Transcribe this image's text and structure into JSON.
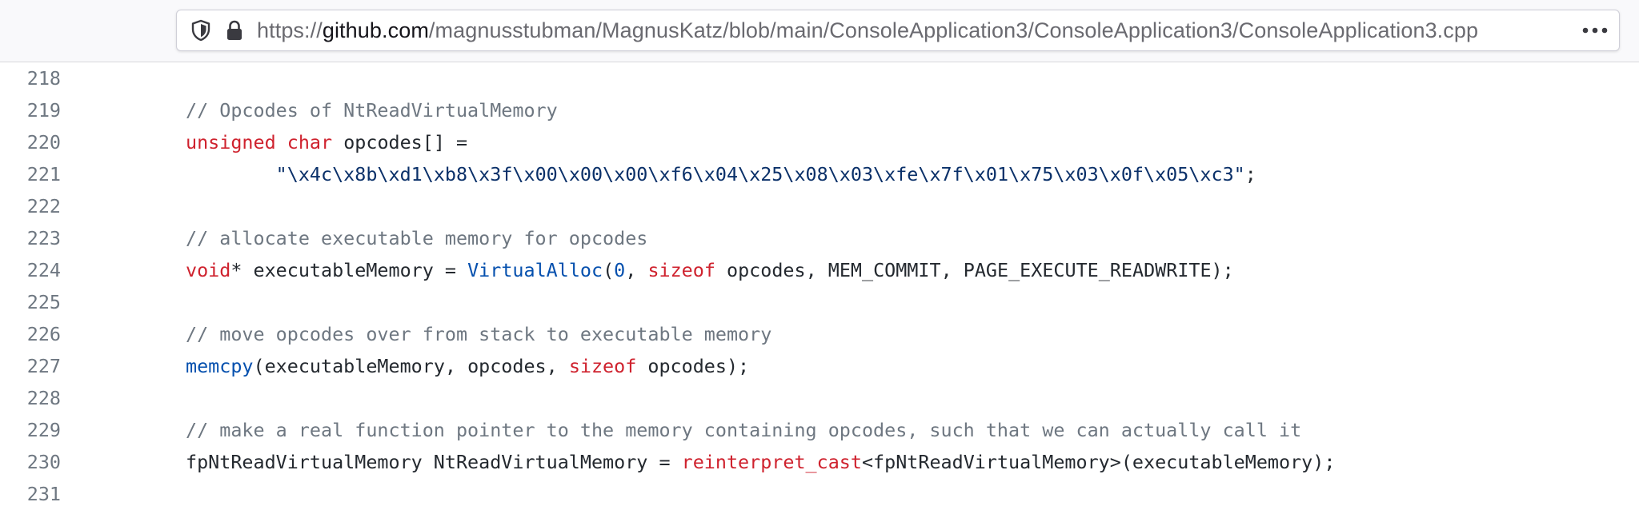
{
  "browser": {
    "url_prefix": "https://",
    "url_host": "github.com",
    "url_path": "/magnusstubman/MagnusKatz/blob/main/ConsoleApplication3/ConsoleApplication3/ConsoleApplication3.cpp",
    "icons": {
      "shield": "tracking-protection-shield-icon",
      "lock": "lock-icon",
      "menu": "more-horizontal-icon"
    }
  },
  "colors": {
    "comment": "#6e7781",
    "keyword": "#cf222e",
    "function": "#0550ae",
    "string": "#0a3069",
    "text": "#24292f",
    "line_number": "#6e7781"
  },
  "code": {
    "lines": [
      {
        "num": "218",
        "indent": "",
        "tokens": []
      },
      {
        "num": "219",
        "indent": "",
        "tokens": [
          {
            "t": "comment",
            "v": "// Opcodes of NtReadVirtualMemory"
          }
        ]
      },
      {
        "num": "220",
        "indent": "",
        "tokens": [
          {
            "t": "keyword",
            "v": "unsigned"
          },
          {
            "t": "plain",
            "v": " "
          },
          {
            "t": "keyword",
            "v": "char"
          },
          {
            "t": "plain",
            "v": " opcodes[] ="
          }
        ]
      },
      {
        "num": "221",
        "indent": "        ",
        "tokens": [
          {
            "t": "string",
            "v": "\"\\x4c\\x8b\\xd1\\xb8\\x3f\\x00\\x00\\x00\\xf6\\x04\\x25\\x08\\x03\\xfe\\x7f\\x01\\x75\\x03\\x0f\\x05\\xc3\""
          },
          {
            "t": "plain",
            "v": ";"
          }
        ]
      },
      {
        "num": "222",
        "indent": "",
        "tokens": []
      },
      {
        "num": "223",
        "indent": "",
        "tokens": [
          {
            "t": "comment",
            "v": "// allocate executable memory for opcodes"
          }
        ]
      },
      {
        "num": "224",
        "indent": "",
        "tokens": [
          {
            "t": "keyword",
            "v": "void"
          },
          {
            "t": "plain",
            "v": "* executableMemory = "
          },
          {
            "t": "func",
            "v": "VirtualAlloc"
          },
          {
            "t": "plain",
            "v": "("
          },
          {
            "t": "number",
            "v": "0"
          },
          {
            "t": "plain",
            "v": ", "
          },
          {
            "t": "keyword",
            "v": "sizeof"
          },
          {
            "t": "plain",
            "v": " opcodes, MEM_COMMIT, PAGE_EXECUTE_READWRITE);"
          }
        ]
      },
      {
        "num": "225",
        "indent": "",
        "tokens": []
      },
      {
        "num": "226",
        "indent": "",
        "tokens": [
          {
            "t": "comment",
            "v": "// move opcodes over from stack to executable memory"
          }
        ]
      },
      {
        "num": "227",
        "indent": "",
        "tokens": [
          {
            "t": "func",
            "v": "memcpy"
          },
          {
            "t": "plain",
            "v": "(executableMemory, opcodes, "
          },
          {
            "t": "keyword",
            "v": "sizeof"
          },
          {
            "t": "plain",
            "v": " opcodes);"
          }
        ]
      },
      {
        "num": "228",
        "indent": "",
        "tokens": []
      },
      {
        "num": "229",
        "indent": "",
        "tokens": [
          {
            "t": "comment",
            "v": "// make a real function pointer to the memory containing opcodes, such that we can actually call it"
          }
        ]
      },
      {
        "num": "230",
        "indent": "",
        "tokens": [
          {
            "t": "plain",
            "v": "fpNtReadVirtualMemory NtReadVirtualMemory = "
          },
          {
            "t": "keyword",
            "v": "reinterpret_cast"
          },
          {
            "t": "plain",
            "v": "<fpNtReadVirtualMemory>(executableMemory);"
          }
        ]
      },
      {
        "num": "231",
        "indent": "",
        "tokens": []
      }
    ]
  }
}
